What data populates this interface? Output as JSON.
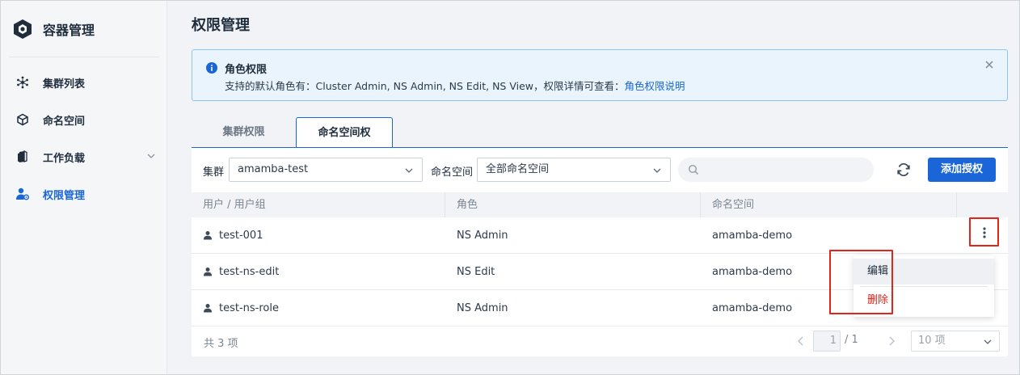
{
  "app": {
    "title": "容器管理"
  },
  "sidebar": {
    "items": [
      {
        "label": "集群列表",
        "icon": "cluster-icon"
      },
      {
        "label": "命名空间",
        "icon": "cube-icon"
      },
      {
        "label": "工作负载",
        "icon": "workload-icon"
      },
      {
        "label": "权限管理",
        "icon": "user-permission-icon",
        "active": true
      }
    ]
  },
  "page": {
    "title": "权限管理"
  },
  "alert": {
    "title": "角色权限",
    "body": "支持的默认角色有：Cluster Admin, NS Admin, NS Edit, NS View，权限详情可查看：",
    "link": "角色权限说明"
  },
  "tabs": [
    {
      "label": "集群权限",
      "active": false
    },
    {
      "label": "命名空间权限",
      "active": true
    }
  ],
  "filters": {
    "cluster_label": "集群",
    "cluster_value": "amamba-test",
    "namespace_label": "命名空间",
    "namespace_value": "全部命名空间",
    "search_placeholder": ""
  },
  "toolbar": {
    "add_label": "添加授权"
  },
  "table": {
    "headers": [
      "用户 / 用户组",
      "角色",
      "命名空间"
    ],
    "rows": [
      {
        "user": "test-001",
        "role": "NS Admin",
        "namespace": "amamba-demo"
      },
      {
        "user": "test-ns-edit",
        "role": "NS Edit",
        "namespace": "amamba-demo"
      },
      {
        "user": "test-ns-role",
        "role": "NS Admin",
        "namespace": "amamba-demo"
      }
    ]
  },
  "menu": {
    "edit": "编辑",
    "delete": "删除"
  },
  "pagination": {
    "total": "共 3 项",
    "page": "1",
    "of": "/ 1",
    "page_size": "10 项"
  },
  "colors": {
    "accent": "#1a66d9",
    "danger": "#e0251b",
    "alert_bg": "#e9f4fd"
  }
}
